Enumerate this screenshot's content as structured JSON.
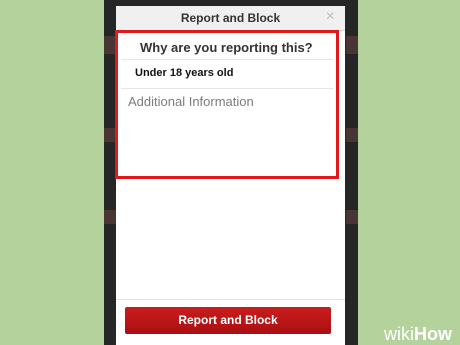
{
  "modal": {
    "title": "Report and Block",
    "close_icon": "×"
  },
  "form": {
    "question": "Why are you reporting this?",
    "selected_reason": "Under 18 years old",
    "additional_placeholder": "Additional Information"
  },
  "footer": {
    "report_button_label": "Report and Block"
  },
  "watermark": {
    "wiki": "wiki",
    "how": "How"
  },
  "colors": {
    "background": "#b3d29c",
    "highlight": "#e0191b",
    "button": "#bd171a"
  }
}
